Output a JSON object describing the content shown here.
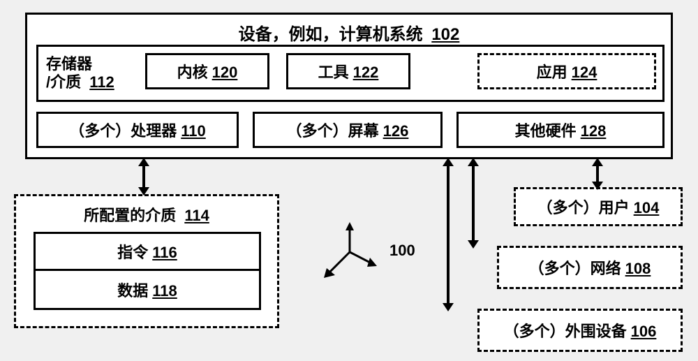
{
  "device": {
    "label": "设备，例如，计算机系统",
    "ref": "102"
  },
  "memory": {
    "label1": "存储器",
    "label2": "/介质",
    "ref": "112"
  },
  "kernel": {
    "label": "内核",
    "ref": "120"
  },
  "tools": {
    "label": "工具",
    "ref": "122"
  },
  "apps": {
    "label": "应用",
    "ref": "124"
  },
  "processors": {
    "label": "（多个）处理器",
    "ref": "110"
  },
  "screens": {
    "label": "（多个）屏幕",
    "ref": "126"
  },
  "other_hw": {
    "label": "其他硬件",
    "ref": "128"
  },
  "config_media": {
    "label": "所配置的介质",
    "ref": "114"
  },
  "instructions": {
    "label": "指令",
    "ref": "116"
  },
  "data_block": {
    "label": "数据",
    "ref": "118"
  },
  "users": {
    "label": "（多个）用户",
    "ref": "104"
  },
  "networks": {
    "label": "（多个）网络",
    "ref": "108"
  },
  "peripherals": {
    "label": "（多个）外围设备",
    "ref": "106"
  },
  "overall_ref": "100"
}
